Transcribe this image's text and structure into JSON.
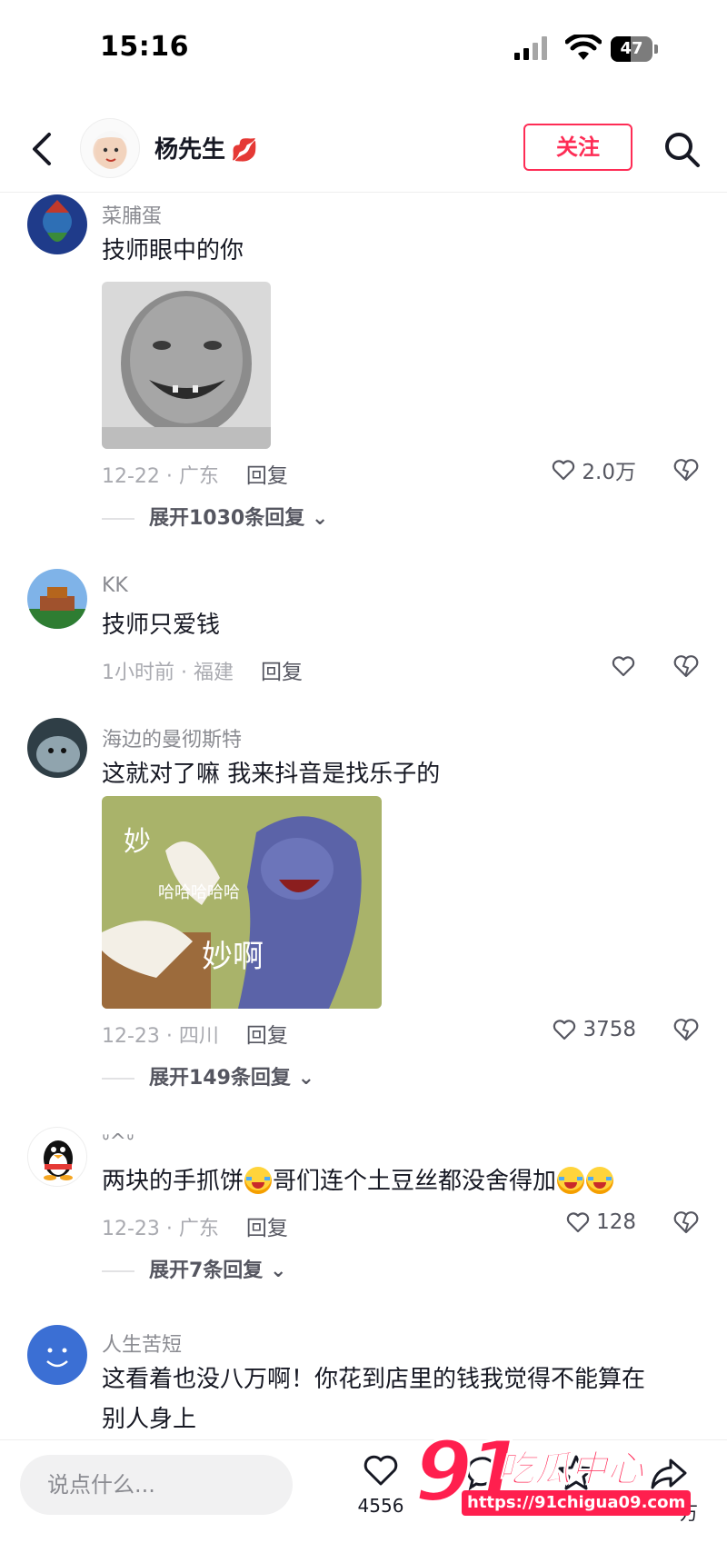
{
  "status_bar": {
    "time": "15:16",
    "battery": "47",
    "battery_level": 0.47
  },
  "header": {
    "name": "杨先生",
    "name_emoji": "lips-icon",
    "follow_label": "关注"
  },
  "comments": [
    {
      "author": "菜脯蛋",
      "text": "技师眼中的你",
      "has_image": true,
      "date": "12-22 · 广东",
      "reply": "回复",
      "likes": "2.0万",
      "expand": "展开1030条回复"
    },
    {
      "author": "KK",
      "text": "技师只爱钱",
      "has_image": false,
      "date": "1小时前 · 福建",
      "reply": "回复",
      "likes": "",
      "expand": ""
    },
    {
      "author": "海边的曼彻斯特",
      "text": "这就对了嘛   我来抖音是找乐子的",
      "has_image": true,
      "image_caption_1": "妙",
      "image_caption_2": "哈哈哈哈哈",
      "image_caption_3": "妙啊",
      "date": "12-23 · 四川",
      "reply": "回复",
      "likes": "3758",
      "expand": "展开149条回复"
    },
    {
      "author": "ᐡ^ᐡ",
      "text_part1": "两块的手抓饼",
      "text_part2": "哥们连个土豆丝都没舍得加",
      "date": "12-23 · 广东",
      "reply": "回复",
      "likes": "128",
      "expand": "展开7条回复"
    },
    {
      "author": "人生苦短",
      "text_line1": "这看着也没八万啊！你花到店里的钱我觉得不能算在",
      "text_line2": "别人身上"
    }
  ],
  "bottom_bar": {
    "input_placeholder": "说点什么...",
    "like_count": "4556",
    "share_count": "万"
  },
  "watermark": {
    "number": "91",
    "name": "吃瓜中心",
    "url": "https://91chigua09.com"
  },
  "colors": {
    "accent": "#fe2c55",
    "text": "#161823",
    "muted": "#8a8b91"
  }
}
